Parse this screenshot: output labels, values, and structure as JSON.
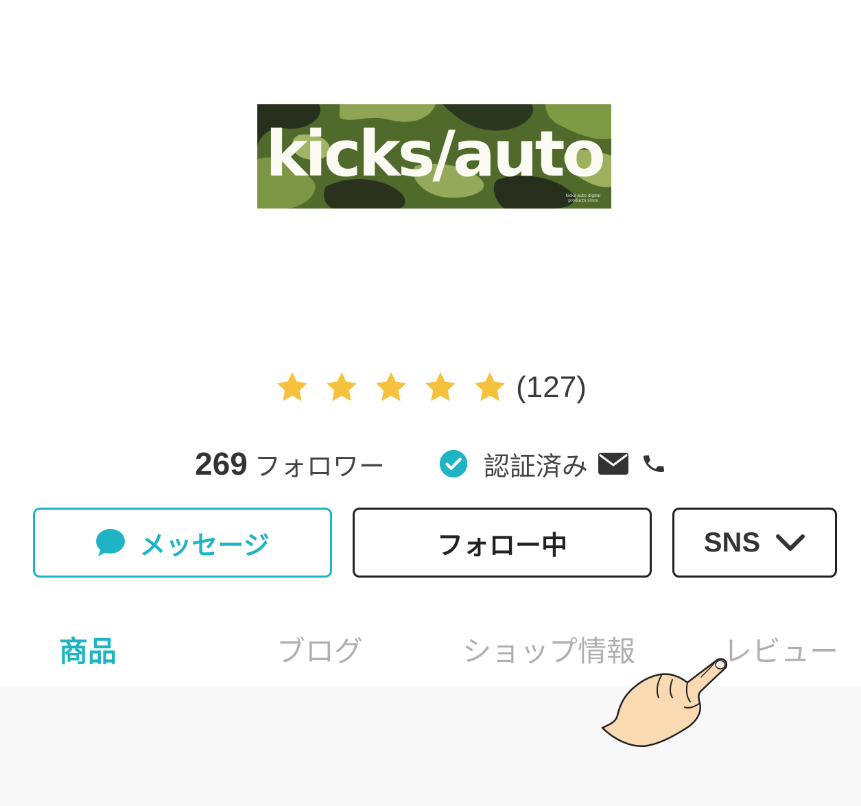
{
  "shop": {
    "logo_text": "kicks/auto",
    "logo_small_text": "kicks auto digital products since"
  },
  "rating": {
    "stars": 5,
    "max_stars": 5,
    "review_count": "(127)",
    "star_color": "#f6c23e"
  },
  "stats": {
    "followers_count": "269",
    "followers_label": "フォロワー",
    "verified_label": "認証済み"
  },
  "buttons": {
    "message_label": "メッセージ",
    "follow_label": "フォロー中",
    "sns_label": "SNS"
  },
  "tabs": [
    {
      "label": "商品",
      "active": true
    },
    {
      "label": "ブログ",
      "active": false
    },
    {
      "label": "ショップ情報",
      "active": false
    },
    {
      "label": "レビュー",
      "active": false
    }
  ],
  "colors": {
    "accent": "#1eb4c3",
    "inactive_tab": "#b0b0b0",
    "text": "#333333"
  },
  "icons": {
    "message": "chat-bubble-icon",
    "verified": "check-circle-icon",
    "mail": "envelope-icon",
    "phone": "phone-icon",
    "sns": "chevron-down-icon",
    "pointer": "pointing-hand-icon"
  }
}
